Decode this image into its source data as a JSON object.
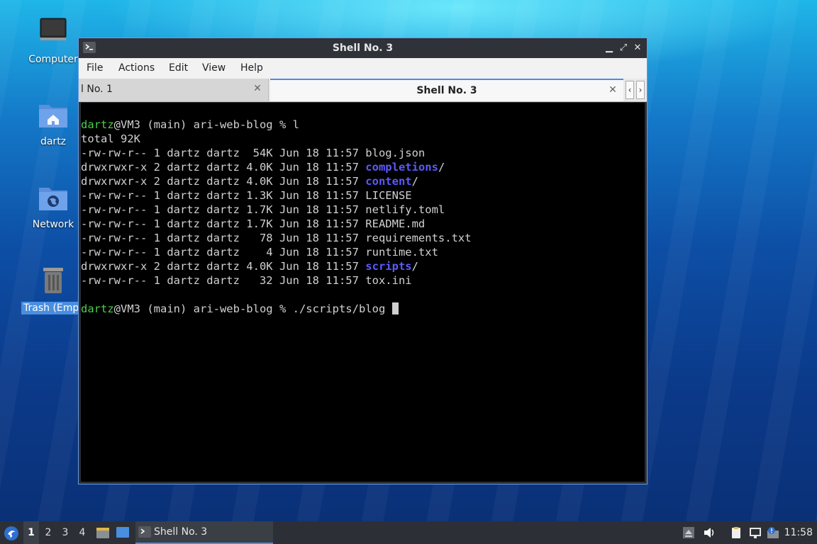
{
  "desktop": {
    "icons": [
      {
        "label": "Computer",
        "icon": "computer-icon"
      },
      {
        "label": "dartz",
        "icon": "home-folder-icon"
      },
      {
        "label": "Network",
        "icon": "network-folder-icon"
      },
      {
        "label": "Trash (Empty)",
        "icon": "trash-icon"
      }
    ]
  },
  "window": {
    "title": "Shell No. 3",
    "menu": [
      "File",
      "Actions",
      "Edit",
      "View",
      "Help"
    ],
    "tabs": [
      {
        "label": "l No. 1",
        "active": false
      },
      {
        "label": "Shell No. 3",
        "active": true
      }
    ],
    "controls": {
      "minimize": "▁",
      "maximize": "⤢",
      "close": "✕"
    },
    "tab_close": "✕",
    "tab_scroll_left": "‹",
    "tab_scroll_right": "›"
  },
  "terminal": {
    "prompt_user": "dartz",
    "prompt_rest": "@VM3 (main) ari-web-blog % ",
    "command1": "l",
    "total": "total 92K",
    "listing": [
      {
        "info": "-rw-rw-r-- 1 dartz dartz  54K Jun 18 11:57 ",
        "name": "blog.json",
        "dir": false
      },
      {
        "info": "drwxrwxr-x 2 dartz dartz 4.0K Jun 18 11:57 ",
        "name": "completions",
        "dir": true
      },
      {
        "info": "drwxrwxr-x 2 dartz dartz 4.0K Jun 18 11:57 ",
        "name": "content",
        "dir": true
      },
      {
        "info": "-rw-rw-r-- 1 dartz dartz 1.3K Jun 18 11:57 ",
        "name": "LICENSE",
        "dir": false
      },
      {
        "info": "-rw-rw-r-- 1 dartz dartz 1.7K Jun 18 11:57 ",
        "name": "netlify.toml",
        "dir": false
      },
      {
        "info": "-rw-rw-r-- 1 dartz dartz 1.7K Jun 18 11:57 ",
        "name": "README.md",
        "dir": false
      },
      {
        "info": "-rw-rw-r-- 1 dartz dartz   78 Jun 18 11:57 ",
        "name": "requirements.txt",
        "dir": false
      },
      {
        "info": "-rw-rw-r-- 1 dartz dartz    4 Jun 18 11:57 ",
        "name": "runtime.txt",
        "dir": false
      },
      {
        "info": "drwxrwxr-x 2 dartz dartz 4.0K Jun 18 11:57 ",
        "name": "scripts",
        "dir": true
      },
      {
        "info": "-rw-rw-r-- 1 dartz dartz   32 Jun 18 11:57 ",
        "name": "tox.ini",
        "dir": false
      }
    ],
    "command2": "./scripts/blog "
  },
  "taskbar": {
    "workspaces": [
      "1",
      "2",
      "3",
      "4"
    ],
    "current_workspace": "1",
    "task_label": "Shell No. 3",
    "clock": "11:58"
  },
  "colors": {
    "prompt_green": "#4bd04b",
    "dir_blue": "#5a5aff",
    "accent": "#4a8ee0"
  }
}
